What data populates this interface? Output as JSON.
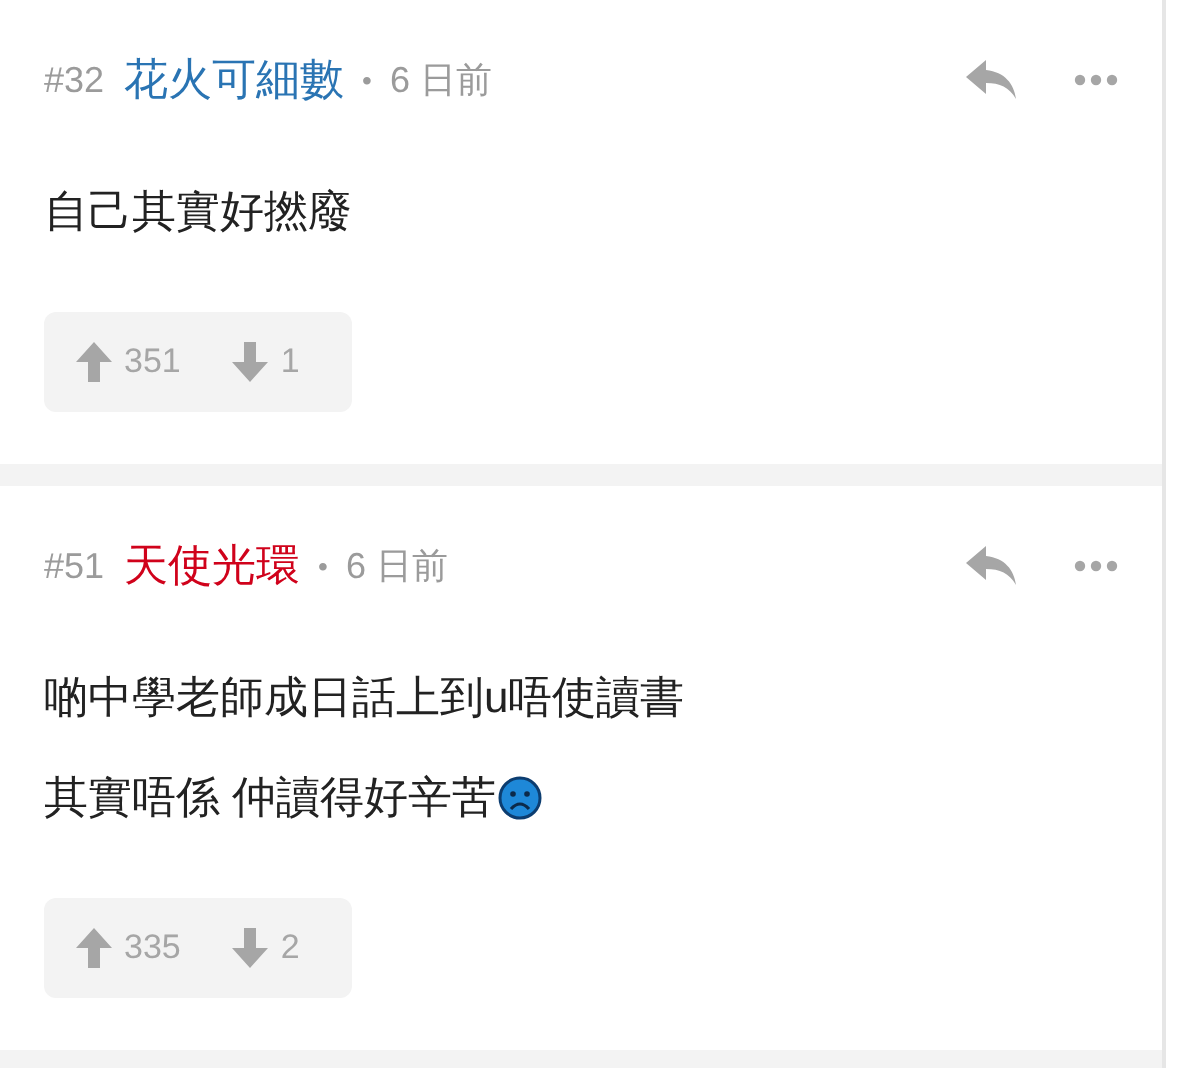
{
  "posts": [
    {
      "number": "#32",
      "author": {
        "name": "花火可細數",
        "color": "#2a74b3"
      },
      "separator": "•",
      "time": "6 日前",
      "lines": [
        "自己其實好撚廢"
      ],
      "upvotes": "351",
      "downvotes": "1"
    },
    {
      "number": "#51",
      "author": {
        "name": "天使光環",
        "color": "#d0021b"
      },
      "separator": "•",
      "time": "6 日前",
      "lines": [
        "啲中學老師成日話上到u唔使讀書",
        "其實唔係 仲讀得好辛苦"
      ],
      "sad_emoji": true,
      "upvotes": "335",
      "downvotes": "2"
    }
  ]
}
